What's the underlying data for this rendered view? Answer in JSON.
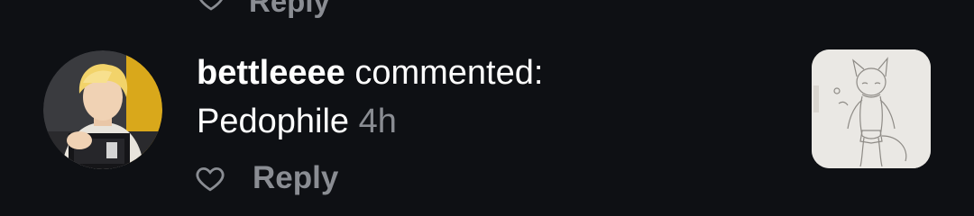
{
  "previous_notification": {
    "reply_label": "Reply"
  },
  "notification": {
    "username": "bettleeee",
    "action_text": "commented:",
    "comment_text": "Pedophile",
    "time_ago": "4h",
    "reply_label": "Reply",
    "like_icon": "heart-outline-icon",
    "colors": {
      "background": "#0e1014",
      "primary_text": "#ffffff",
      "secondary_text": "#8a8d93"
    }
  }
}
